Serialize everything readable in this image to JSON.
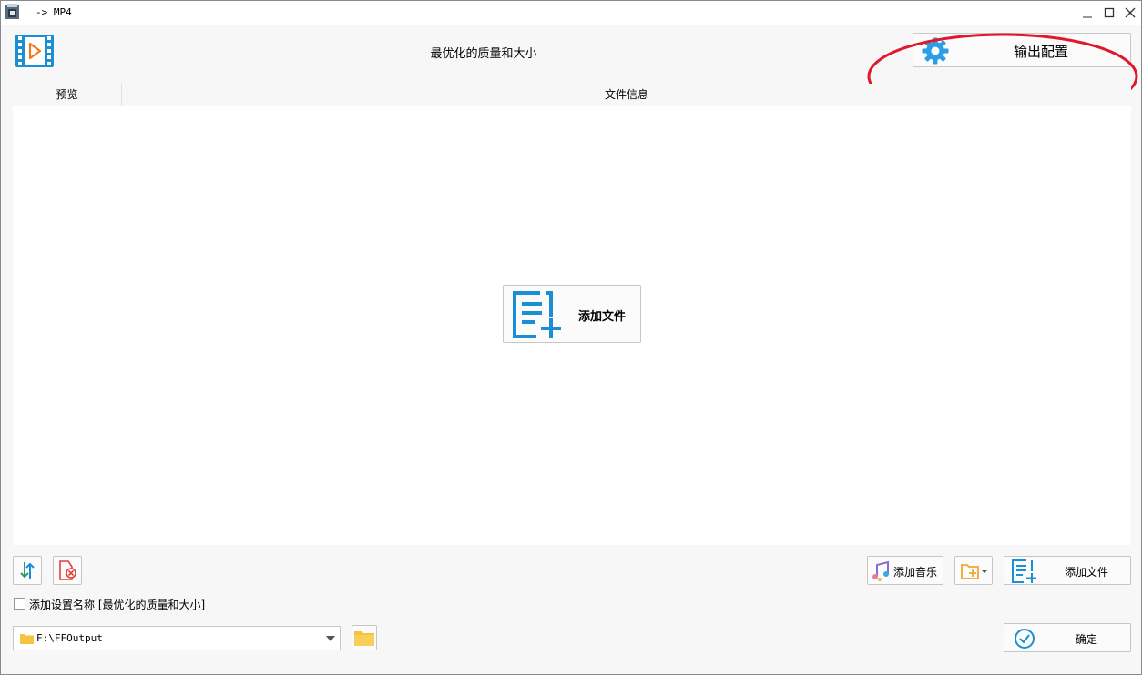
{
  "window": {
    "title": "-> MP4"
  },
  "header": {
    "profile_title": "最优化的质量和大小",
    "output_config_label": "输出配置",
    "annotation_color": "#e0192a"
  },
  "list": {
    "columns": [
      "预览",
      "文件信息"
    ],
    "add_file_center_label": "添加文件"
  },
  "toolbar": {
    "add_music_label": "添加音乐",
    "add_file_label": "添加文件"
  },
  "options": {
    "add_setting_name_label": "添加设置名称 [最优化的质量和大小]",
    "add_setting_name_checked": false
  },
  "output": {
    "path": "F:\\FFOutput",
    "ok_label": "确定"
  },
  "colors": {
    "accent_blue": "#1a8fd6",
    "folder_yellow": "#f5c242",
    "remove_red": "#e0413c"
  },
  "icons": {
    "app": "app-icon",
    "video": "video-file-icon",
    "gear": "gear-icon",
    "add_file": "add-file-icon",
    "sort": "sort-icon",
    "remove": "remove-file-icon",
    "music": "music-note-icon",
    "add_folder": "add-folder-icon",
    "folder": "folder-icon",
    "ok": "check-circle-icon"
  }
}
